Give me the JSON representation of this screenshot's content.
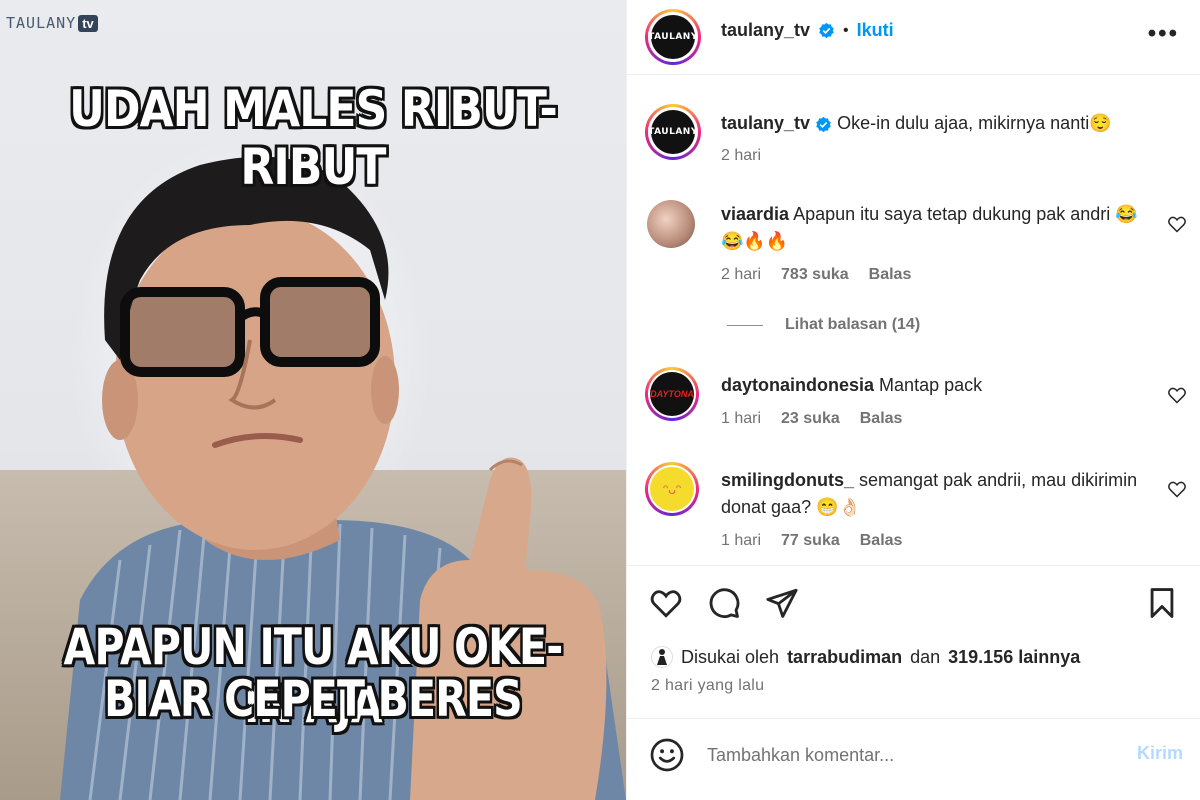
{
  "photo": {
    "watermark_text": "TAULANY",
    "watermark_badge": "tv",
    "meme_top": "UDAH MALES RIBUT-RIBUT",
    "meme_bottom_line1": "APAPUN ITU AKU OKE-IN AJA",
    "meme_bottom_line2": "BIAR CEPET BERES"
  },
  "header": {
    "username": "taulany_tv",
    "separator": "•",
    "follow_label": "Ikuti",
    "more_label": "•••"
  },
  "caption": {
    "username": "taulany_tv",
    "text": "Oke-in dulu ajaa, mikirnya nanti😌",
    "time": "2 hari"
  },
  "comments": [
    {
      "username": "viaardia",
      "text": "Apapun itu saya tetap dukung pak andri 😂😂🔥🔥",
      "time": "2 hari",
      "likes": "783 suka",
      "reply": "Balas"
    },
    {
      "username": "daytonaindonesia",
      "text": "Mantap pack",
      "time": "1 hari",
      "likes": "23 suka",
      "reply": "Balas"
    },
    {
      "username": "smilingdonuts_",
      "text": "semangat pak andrii, mau dikirimin donat gaa? 😁👌🏻",
      "time": "1 hari",
      "likes": "77 suka",
      "reply": "Balas"
    }
  ],
  "replies_label": "Lihat balasan (14)",
  "likes": {
    "prefix": "Disukai oleh",
    "user": "tarrabudiman",
    "middle": "dan",
    "count": "319.156 lainnya"
  },
  "posted_ago": "2 hari yang lalu",
  "add_comment": {
    "placeholder": "Tambahkan komentar...",
    "post_label": "Kirim"
  },
  "colors": {
    "accent": "#0095f6",
    "post_disabled": "#b3dbff",
    "meta_text": "#737373"
  }
}
